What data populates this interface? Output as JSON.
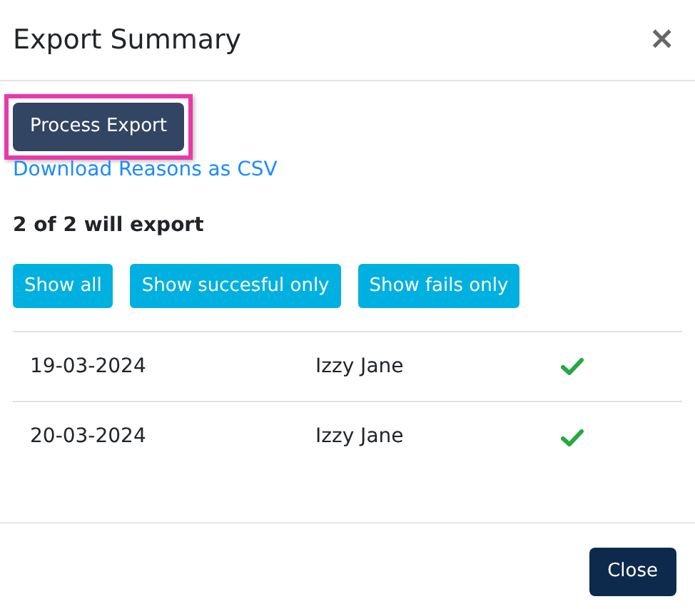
{
  "dialog": {
    "title": "Export Summary",
    "close_icon": "×"
  },
  "process_button": {
    "label": "Process Export",
    "highlighted": true
  },
  "download_link": "Download Reasons as CSV",
  "summary": "2 of 2 will export",
  "filters": [
    {
      "label": "Show all"
    },
    {
      "label": "Show succesful only"
    },
    {
      "label": "Show fails only"
    }
  ],
  "rows": [
    {
      "date": "19-03-2024",
      "name": "Izzy Jane",
      "exported": true
    },
    {
      "date": "20-03-2024",
      "name": "Izzy Jane",
      "exported": true
    }
  ],
  "footer": {
    "close_button": "Close"
  }
}
